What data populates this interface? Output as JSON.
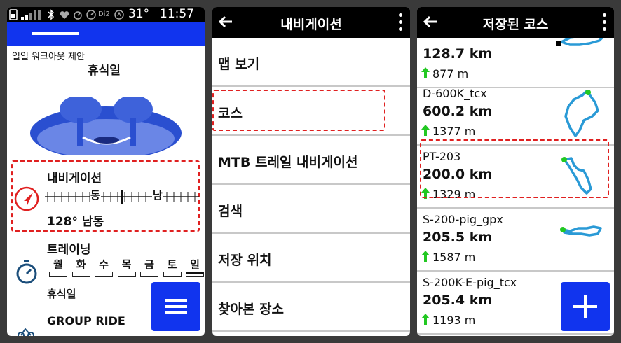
{
  "panel1": {
    "status": {
      "temperature": "31°",
      "time": "11:57"
    },
    "widget_title": "일일 워크아웃 제안",
    "widget_sub": "휴식일",
    "navigation": {
      "title": "내비게이션",
      "compass_left": "동",
      "compass_right": "남",
      "heading": "128° 남동"
    },
    "training": {
      "title": "트레이닝",
      "days": [
        "월",
        "화",
        "수",
        "목",
        "금",
        "토",
        "일"
      ],
      "rest_label": "휴식일"
    },
    "group_ride": "GROUP RIDE",
    "menu_button_icon": "menu-icon"
  },
  "panel2": {
    "title": "내비게이션",
    "items": [
      {
        "label": "맵 보기"
      },
      {
        "label": "코스"
      },
      {
        "label": "MTB 트레일 내비게이션"
      },
      {
        "label": "검색"
      },
      {
        "label": "저장 위치"
      },
      {
        "label": "찾아본 장소"
      }
    ]
  },
  "panel3": {
    "title": "저장된 코스",
    "courses": [
      {
        "name": "",
        "distance": "128.7 km",
        "elevation": "877 m"
      },
      {
        "name": "D-600K_tcx",
        "distance": "600.2 km",
        "elevation": "1377 m"
      },
      {
        "name": "PT-203",
        "distance": "200.0 km",
        "elevation": "1329 m"
      },
      {
        "name": "S-200-pig_gpx",
        "distance": "205.5 km",
        "elevation": "1587 m"
      },
      {
        "name": "S-200K-E-pig_tcx",
        "distance": "205.4 km",
        "elevation": "1193 m"
      }
    ],
    "add_button_icon": "plus-icon"
  },
  "colors": {
    "accent_blue": "#1134ee",
    "highlight_red": "#e02020",
    "route_blue": "#2a9ad6",
    "elevation_green": "#22c822"
  }
}
